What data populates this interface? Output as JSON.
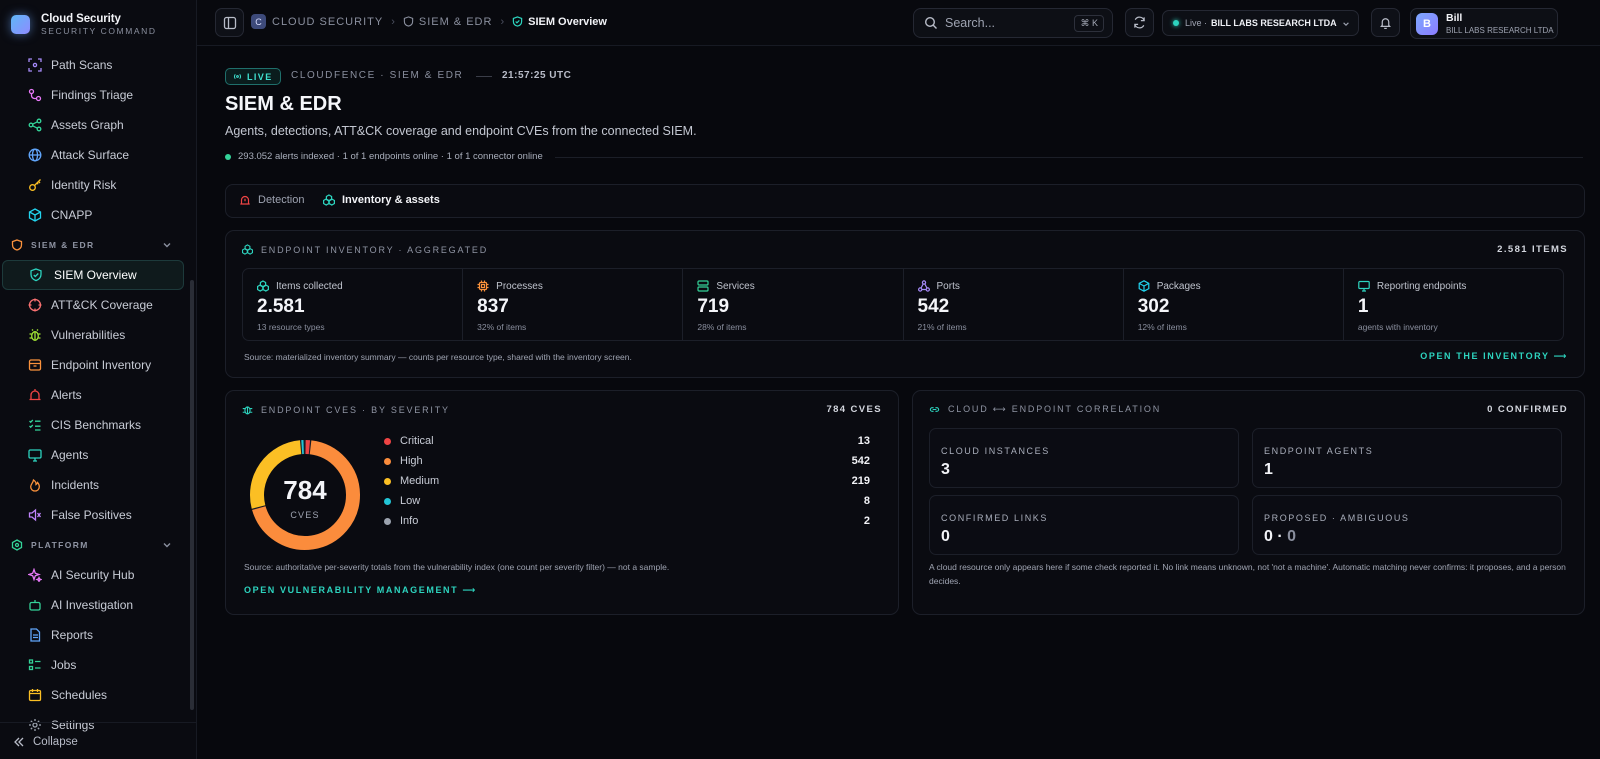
{
  "brand": {
    "title": "Cloud Security",
    "subtitle": "SECURITY COMMAND"
  },
  "sidebar": {
    "items_top": [
      {
        "label": "Path Scans",
        "icon": "path-scan-icon"
      },
      {
        "label": "Findings Triage",
        "icon": "triage-icon"
      },
      {
        "label": "Assets Graph",
        "icon": "graph-icon"
      },
      {
        "label": "Attack Surface",
        "icon": "globe-icon"
      },
      {
        "label": "Identity Risk",
        "icon": "key-icon"
      },
      {
        "label": "CNAPP",
        "icon": "cube-icon"
      }
    ],
    "section_siem": "SIEM & EDR",
    "items_siem": [
      {
        "label": "SIEM Overview",
        "icon": "shield-check-icon",
        "active": true
      },
      {
        "label": "ATT&CK Coverage",
        "icon": "crosshair-icon"
      },
      {
        "label": "Vulnerabilities",
        "icon": "bug-icon"
      },
      {
        "label": "Endpoint Inventory",
        "icon": "box-icon"
      },
      {
        "label": "Alerts",
        "icon": "siren-icon"
      },
      {
        "label": "CIS Benchmarks",
        "icon": "checklist-icon"
      },
      {
        "label": "Agents",
        "icon": "monitor-icon"
      },
      {
        "label": "Incidents",
        "icon": "flame-icon"
      },
      {
        "label": "False Positives",
        "icon": "mute-icon"
      }
    ],
    "section_platform": "PLATFORM",
    "items_platform": [
      {
        "label": "AI Security Hub",
        "icon": "sparkles-icon"
      },
      {
        "label": "AI Investigation",
        "icon": "bot-icon"
      },
      {
        "label": "Reports",
        "icon": "file-icon"
      },
      {
        "label": "Jobs",
        "icon": "list-icon"
      },
      {
        "label": "Schedules",
        "icon": "calendar-icon"
      },
      {
        "label": "Settings",
        "icon": "gear-icon"
      }
    ],
    "collapse_label": "Collapse"
  },
  "topbar": {
    "breadcrumb_badge": "C",
    "breadcrumb": [
      "CLOUD SECURITY",
      "SIEM & EDR",
      "SIEM Overview"
    ],
    "search_placeholder": "Search...",
    "search_kbd": "⌘ K",
    "tenant_status": "Live ·",
    "tenant_name": "BILL LABS RESEARCH LTDA",
    "user_initial": "B",
    "user_name": "Bill",
    "user_org": "BILL LABS RESEARCH LTDA"
  },
  "header": {
    "live_label": "LIVE",
    "eyebrow": "CLOUDFENCE · SIEM & EDR",
    "time": "21:57:25 UTC",
    "title": "SIEM & EDR",
    "subtitle": "Agents, detections, ATT&CK coverage and endpoint CVEs from the connected SIEM.",
    "status": "293.052 alerts indexed · 1 of 1 endpoints online · 1 of 1 connector online"
  },
  "tabs": [
    {
      "label": "Detection",
      "icon": "siren-icon",
      "active": false
    },
    {
      "label": "Inventory & assets",
      "icon": "boxes-icon",
      "active": true
    }
  ],
  "inventory": {
    "title": "ENDPOINT INVENTORY · AGGREGATED",
    "count": "2.581 ITEMS",
    "stats": [
      {
        "label": "Items collected",
        "value": "2.581",
        "sub": "13 resource types",
        "icon": "boxes-icon",
        "color": "#2dd4bf"
      },
      {
        "label": "Processes",
        "value": "837",
        "sub": "32% of items",
        "icon": "cpu-icon",
        "color": "#fb923c"
      },
      {
        "label": "Services",
        "value": "719",
        "sub": "28% of items",
        "icon": "server-icon",
        "color": "#34d399"
      },
      {
        "label": "Ports",
        "value": "542",
        "sub": "21% of items",
        "icon": "network-icon",
        "color": "#a78bfa"
      },
      {
        "label": "Packages",
        "value": "302",
        "sub": "12% of items",
        "icon": "package-icon",
        "color": "#22d3ee"
      },
      {
        "label": "Reporting endpoints",
        "value": "1",
        "sub": "agents with inventory",
        "icon": "monitor-icon",
        "color": "#2dd4bf"
      }
    ],
    "source": "Source: materialized inventory summary — counts per resource type, shared with the inventory screen.",
    "link": "OPEN THE INVENTORY ⟶"
  },
  "cves": {
    "title": "ENDPOINT CVES · BY SEVERITY",
    "count": "784 CVES",
    "total": "784",
    "total_label": "CVES",
    "source": "Source: authoritative per-severity totals from the vulnerability index (one count per severity filter) — not a sample.",
    "link": "OPEN VULNERABILITY MANAGEMENT ⟶"
  },
  "chart_data": {
    "type": "pie",
    "categories": [
      "Critical",
      "High",
      "Medium",
      "Low",
      "Info"
    ],
    "values": [
      13,
      542,
      219,
      8,
      2
    ],
    "colors": [
      "#ef4444",
      "#fb8c3c",
      "#fbbf24",
      "#22c5d6",
      "#9ca3af"
    ],
    "donut": true
  },
  "correlation": {
    "title": "CLOUD ⟷ ENDPOINT CORRELATION",
    "count": "0 CONFIRMED",
    "boxes": [
      {
        "label": "CLOUD INSTANCES",
        "value": "3"
      },
      {
        "label": "ENDPOINT AGENTS",
        "value": "1"
      },
      {
        "label": "CONFIRMED LINKS",
        "value": "0"
      },
      {
        "label": "PROPOSED · AMBIGUOUS",
        "value_a": "0",
        "sep": " · ",
        "value_b": "0"
      }
    ],
    "note": "A cloud resource only appears here if some check reported it. No link means unknown, not 'not a machine'. Automatic matching never confirms: it proposes, and a person decides."
  }
}
